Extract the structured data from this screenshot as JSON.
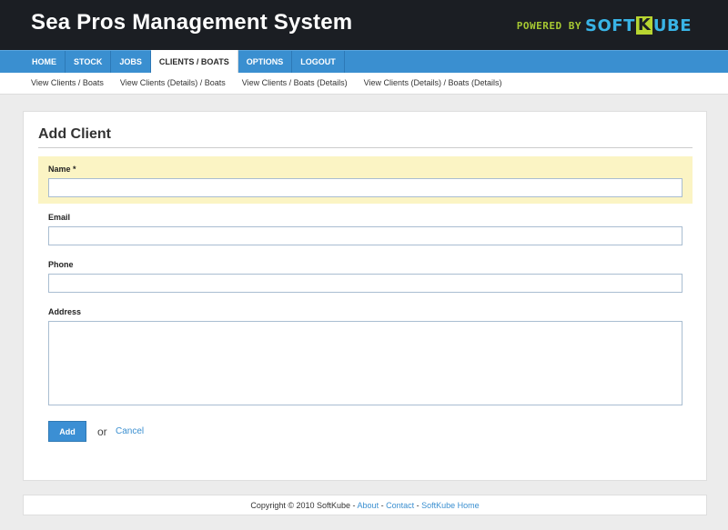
{
  "header": {
    "title": "Sea Pros Management System",
    "powered_by": "POWERED BY",
    "brand_soft": "SOFT",
    "brand_k": "K",
    "brand_ube": "UBE"
  },
  "nav": {
    "tabs": [
      {
        "label": "HOME"
      },
      {
        "label": "STOCK"
      },
      {
        "label": "JOBS"
      },
      {
        "label": "CLIENTS / BOATS"
      },
      {
        "label": "OPTIONS"
      },
      {
        "label": "LOGOUT"
      }
    ],
    "active": "CLIENTS / BOATS"
  },
  "subnav": {
    "links": [
      {
        "label": "View Clients / Boats"
      },
      {
        "label": "View Clients (Details) / Boats"
      },
      {
        "label": "View Clients / Boats (Details)"
      },
      {
        "label": "View Clients (Details) / Boats (Details)"
      }
    ]
  },
  "form": {
    "title": "Add Client",
    "fields": {
      "name": {
        "label": "Name *",
        "value": ""
      },
      "email": {
        "label": "Email",
        "value": ""
      },
      "phone": {
        "label": "Phone",
        "value": ""
      },
      "address": {
        "label": "Address",
        "value": ""
      }
    },
    "submit_label": "Add",
    "or_text": "or",
    "cancel_label": "Cancel"
  },
  "footer": {
    "copyright": "Copyright © 2010 SoftKube - ",
    "about": "About",
    "sep1": " - ",
    "contact": "Contact",
    "sep2": " - ",
    "home": "SoftKube Home"
  },
  "colors": {
    "header_bg": "#1b1e23",
    "nav_bg": "#3a8fd0",
    "required_highlight": "#fbf4c4",
    "brand_green": "#b8d531",
    "brand_blue": "#39b4e6",
    "link": "#3a8fd0"
  }
}
